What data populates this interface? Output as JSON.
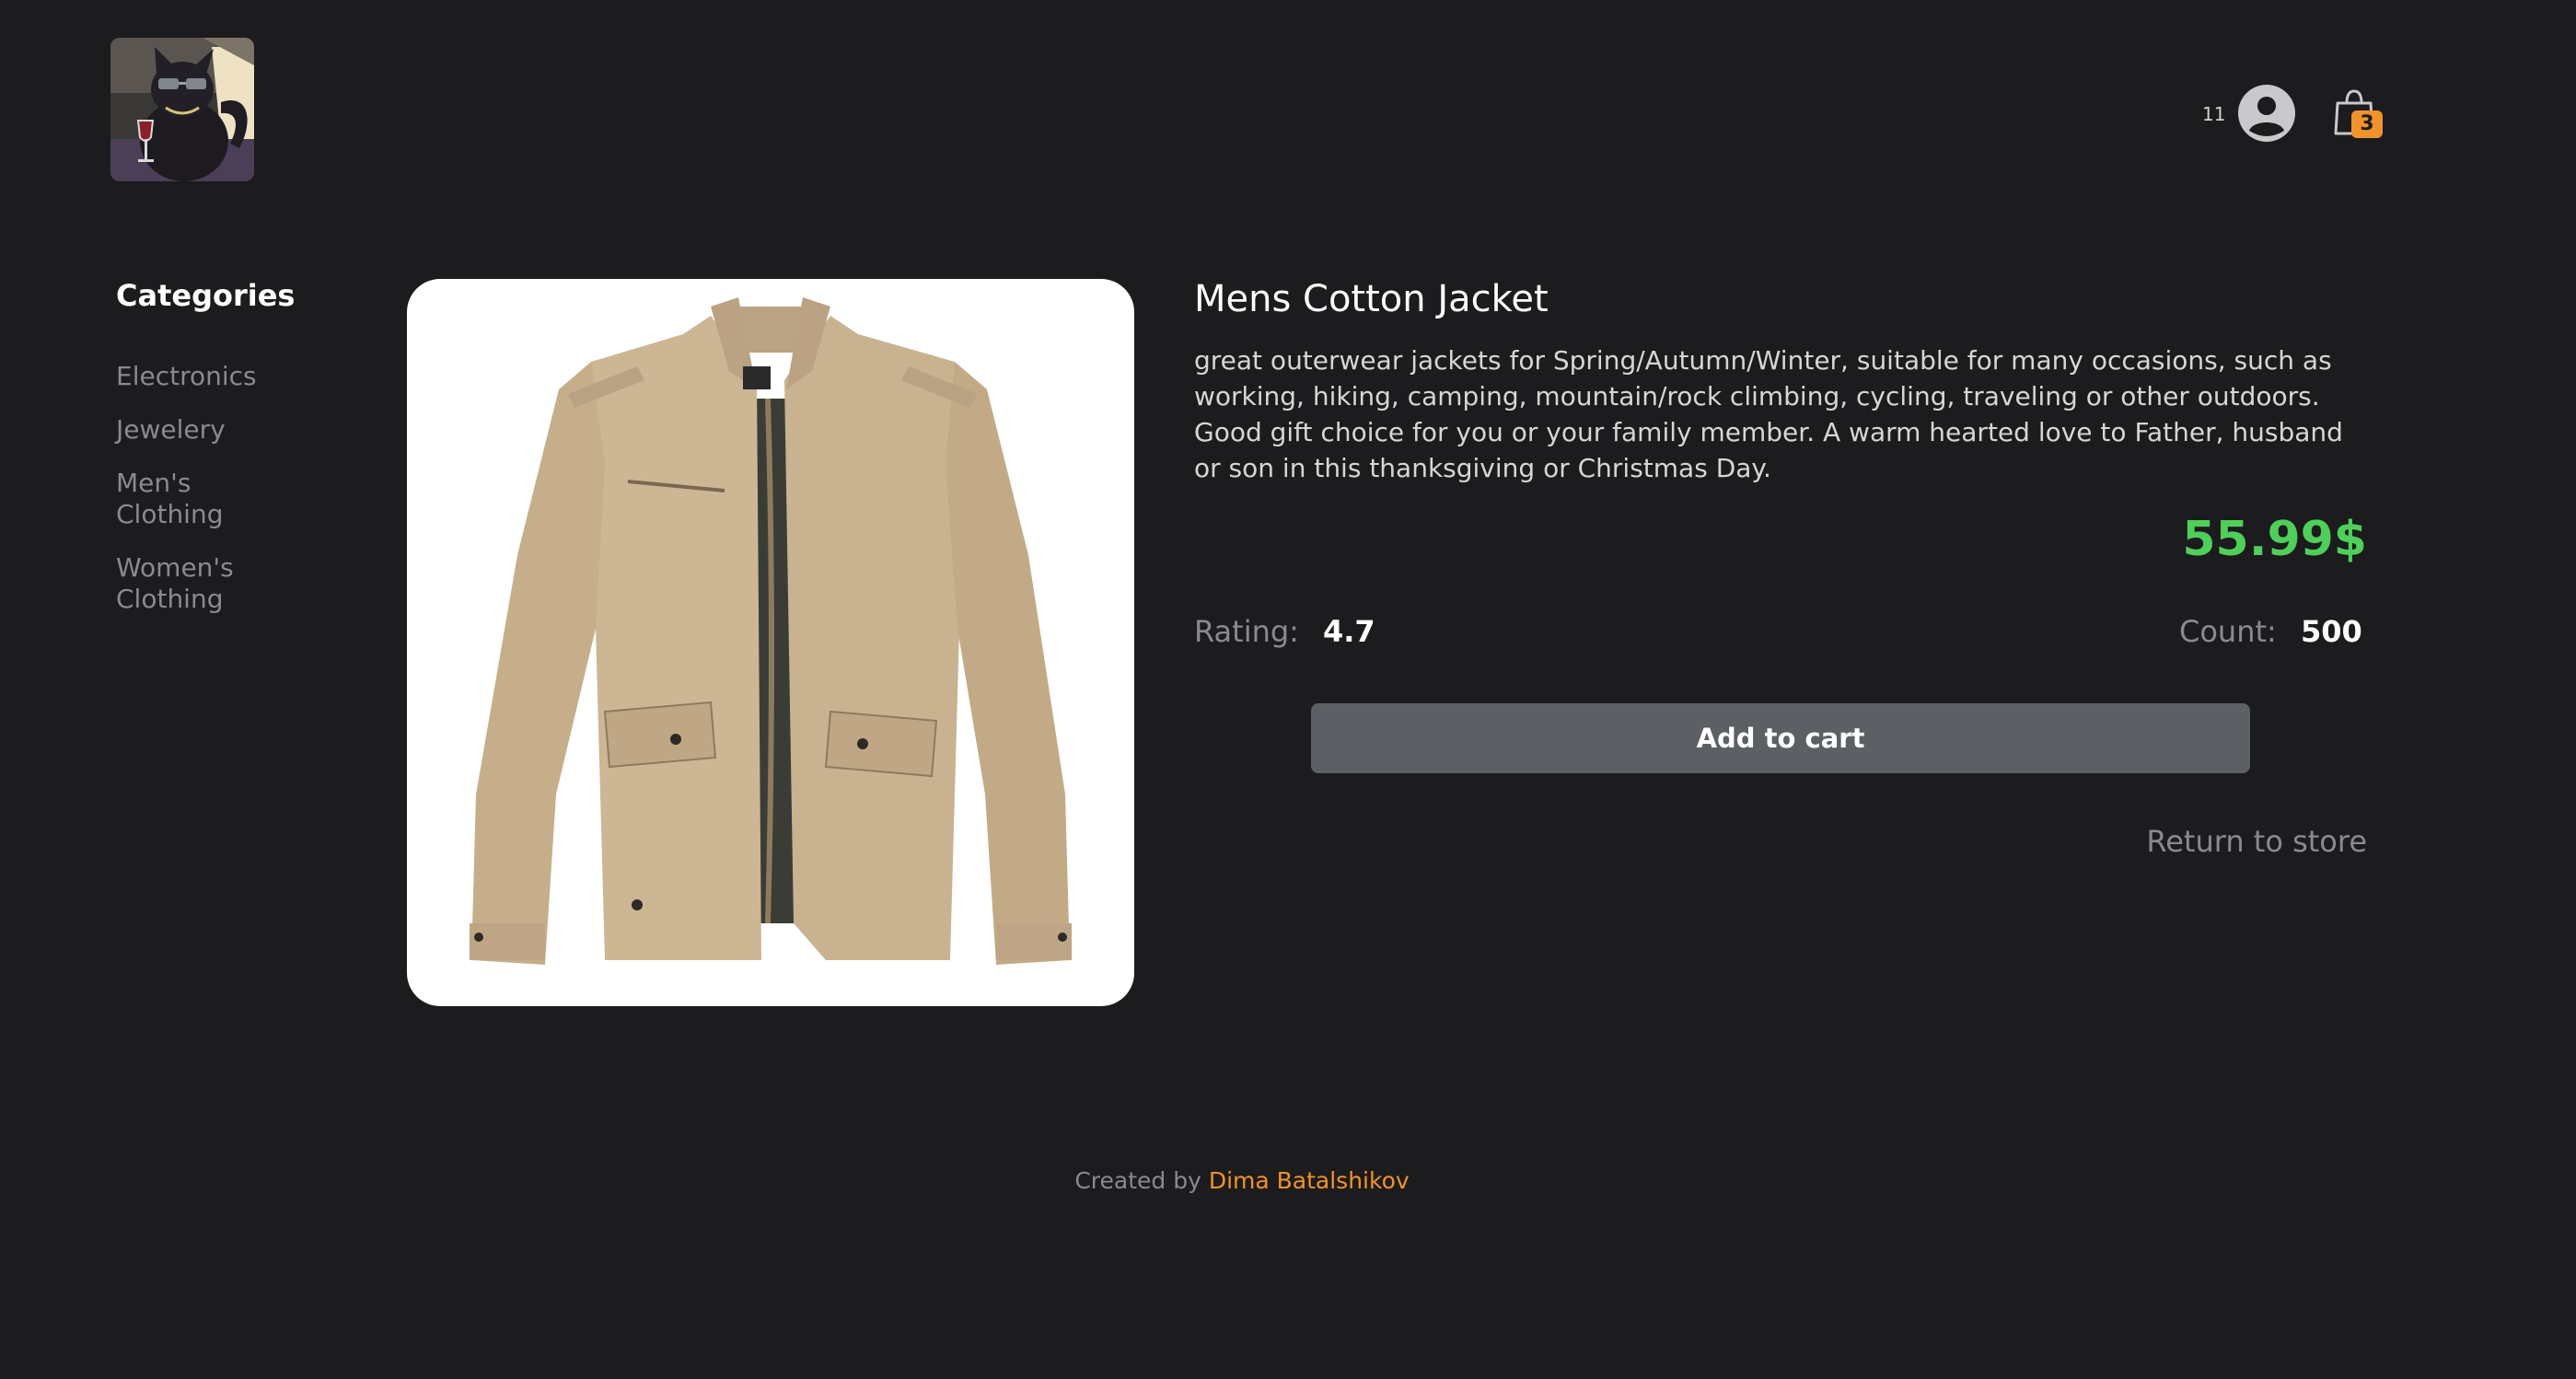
{
  "header": {
    "logo_icon": "cat-with-wine-logo-icon",
    "user_id": "11",
    "user_icon": "user-avatar-icon",
    "cart_icon": "shopping-bag-icon",
    "cart_count": "3"
  },
  "sidebar": {
    "title": "Categories",
    "items": [
      {
        "label": "Electronics"
      },
      {
        "label": "Jewelery"
      },
      {
        "label": "Men's Clothing"
      },
      {
        "label": "Women's Clothing"
      }
    ]
  },
  "product": {
    "image_icon": "jacket-product-image",
    "title": "Mens Cotton Jacket",
    "description": "great outerwear jackets for Spring/Autumn/Winter, suitable for many occasions, such as working, hiking, camping, mountain/rock climbing, cycling, traveling or other outdoors. Good gift choice for you or your family member. A warm hearted love to Father, husband or son in this thanksgiving or Christmas Day.",
    "price": "55.99$",
    "rating_label": "Rating:",
    "rating_value": "4.7",
    "count_label": "Count:",
    "count_value": "500",
    "add_to_cart_label": "Add to cart",
    "return_label": "Return to store"
  },
  "footer": {
    "prefix": "Created by",
    "author": "Dima Batalshikov"
  },
  "colors": {
    "background": "#1c1b1d",
    "price": "#4fcf5a",
    "accent": "#f0932b",
    "button": "#5c6065",
    "muted_text": "#8a8a8e"
  }
}
